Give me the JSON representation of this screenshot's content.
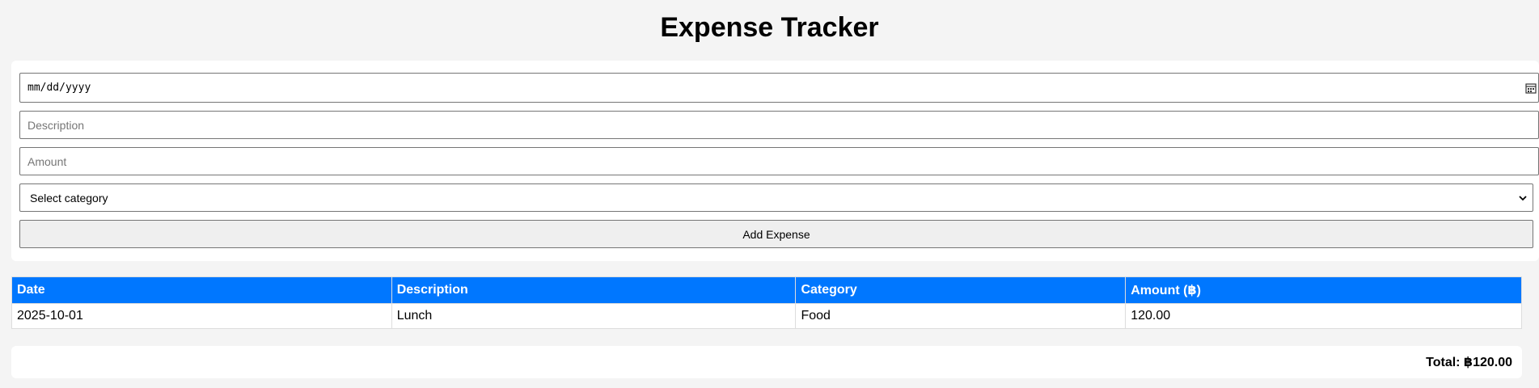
{
  "header": {
    "title": "Expense Tracker"
  },
  "form": {
    "date_placeholder": "mm/dd/yyyy",
    "description_placeholder": "Description",
    "amount_placeholder": "Amount",
    "category_selected": "Select category",
    "add_button_label": "Add Expense"
  },
  "table": {
    "columns": [
      "Date",
      "Description",
      "Category",
      "Amount (฿)"
    ],
    "rows": [
      [
        "2025-10-01",
        "Lunch",
        "Food",
        "120.00"
      ]
    ]
  },
  "summary": {
    "total_text": "Total: ฿120.00"
  },
  "colors": {
    "table_header": "#0077ff",
    "page_background": "#f4f4f4"
  },
  "icons": {
    "date_picker": "calendar-icon",
    "select_dropdown": "chevron-down-icon"
  }
}
